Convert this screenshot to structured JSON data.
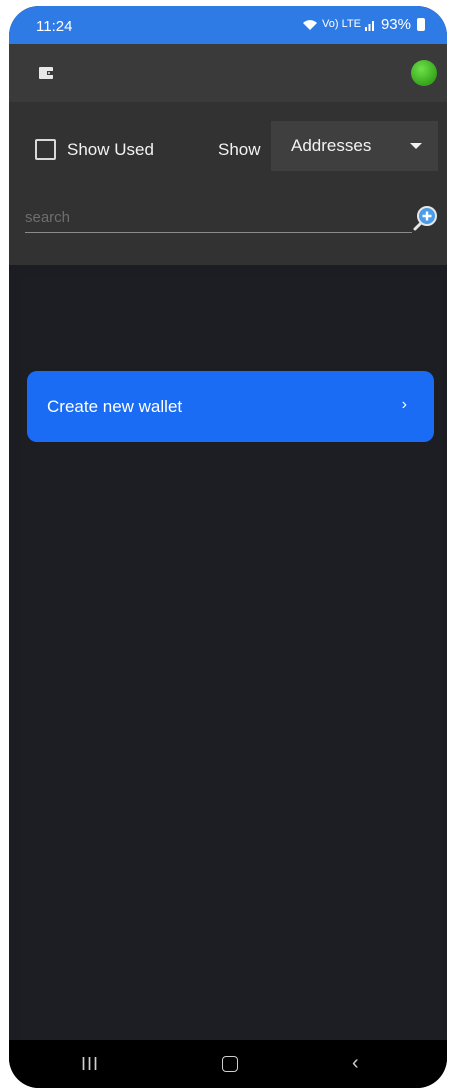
{
  "status_bar": {
    "time": "11:24",
    "signal_text": "Vo) LTE",
    "battery_percent": "93%"
  },
  "app_bar": {
    "wallet_icon": "wallet-icon",
    "connection_status_color": "#4cc52b"
  },
  "filters": {
    "show_used_label": "Show Used",
    "show_used_checked": false,
    "show_label": "Show",
    "show_selected": "Addresses"
  },
  "search": {
    "placeholder": "search",
    "value": ""
  },
  "main": {
    "create_wallet_label": "Create new wallet",
    "create_wallet_chevron": "›"
  },
  "nav_bar": {
    "recents": "III",
    "back": "‹"
  },
  "colors": {
    "status_bar": "#2f7be6",
    "app_bar": "#3a3a3a",
    "panel": "#323232",
    "content": "#1d1e24",
    "accent": "#1a6cf4"
  }
}
